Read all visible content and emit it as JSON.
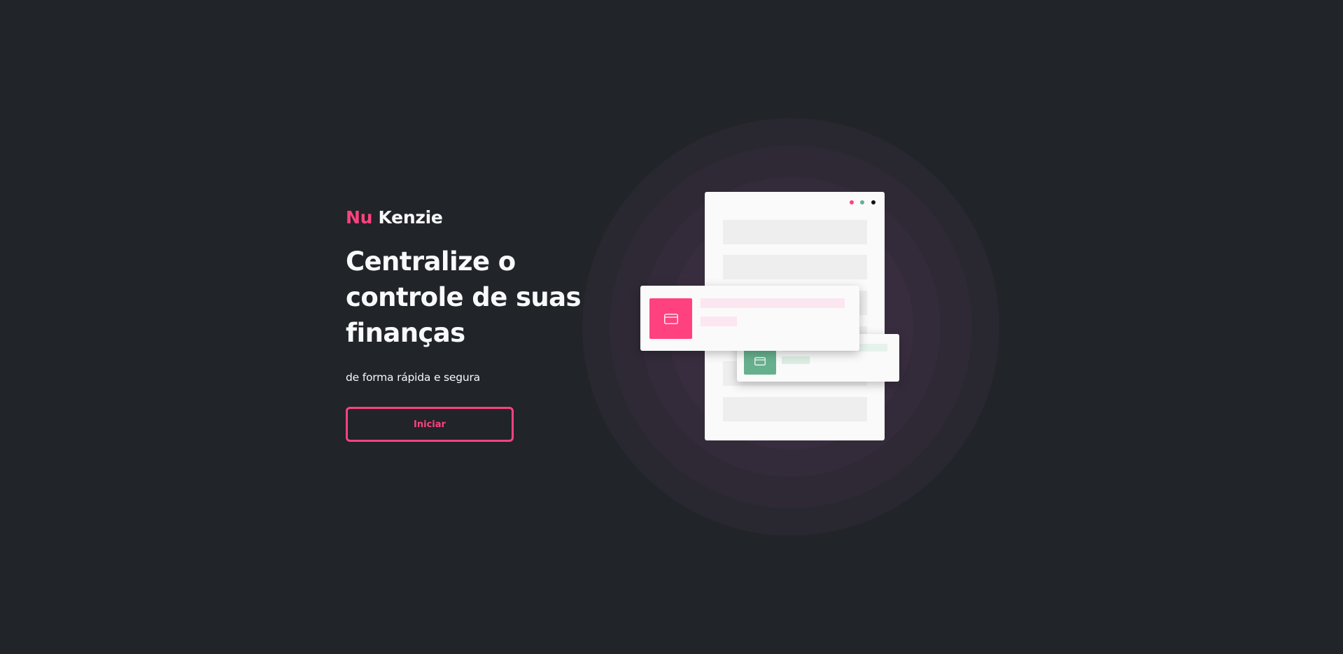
{
  "brand": {
    "name_part1": "Nu",
    "name_part2": "Kenzie",
    "accent_color": "#FF427F",
    "success_color": "#67B08E",
    "background_color": "#212429"
  },
  "hero": {
    "headline": "Centralize o controle de suas finanças",
    "subtitle": "de forma rápida e segura",
    "start_button_label": "Iniciar"
  },
  "illustration": {
    "window_dots": [
      "pink-dot",
      "green-dot",
      "black-dot"
    ],
    "pink_card_icon": "credit-card-icon",
    "green_card_icon": "credit-card-icon"
  }
}
